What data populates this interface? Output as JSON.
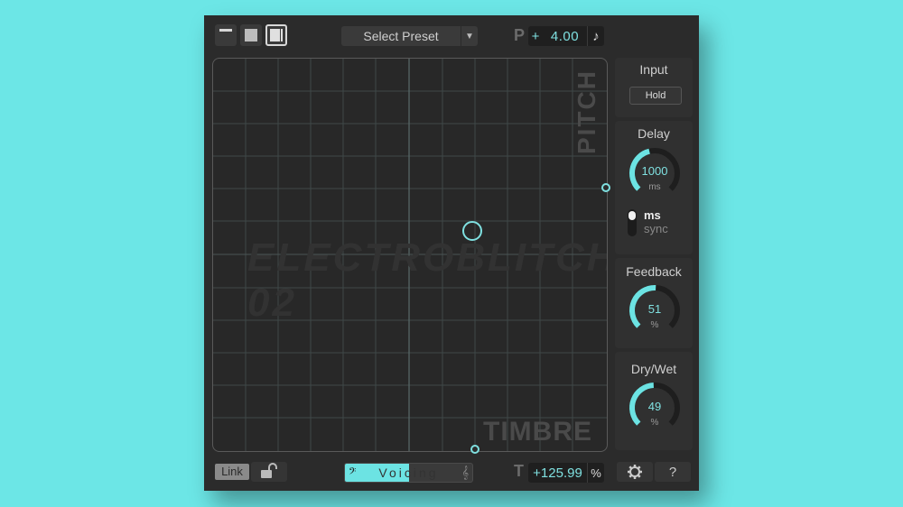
{
  "toolbar": {
    "view_buttons": [
      "minimal-view-icon",
      "medium-view-icon",
      "large-view-icon"
    ],
    "preset_label": "Select Preset",
    "pitch_letter": "P",
    "pitch_sign": "+",
    "pitch_value": "4.00",
    "pitch_unit_icon": "♪"
  },
  "pad": {
    "watermark_pitch": "PITCH",
    "watermark_timbre": "TIMBRE",
    "watermark_logo": "ELECTROBLITCH 02"
  },
  "side": {
    "input": {
      "title": "Input",
      "hold_label": "Hold"
    },
    "delay": {
      "title": "Delay",
      "value": "1000",
      "unit": "ms",
      "level": 0.45
    },
    "delay_mode": {
      "option_on": "ms",
      "option_off": "sync"
    },
    "feedback": {
      "title": "Feedback",
      "value": "51",
      "unit": "%",
      "level": 0.51
    },
    "drywet": {
      "title": "Dry/Wet",
      "value": "49",
      "unit": "%",
      "level": 0.49
    }
  },
  "bottom": {
    "link_label": "Link",
    "voicing_label": "Voicing",
    "voicing_level": 0.5,
    "clef_left": "𝄢",
    "clef_right": "𝄞",
    "timbre_letter": "T",
    "timbre_value": "+125.99",
    "timbre_unit": "%",
    "help_label": "?"
  },
  "colors": {
    "accent": "#6ce3e3",
    "panel": "#2b2b2b",
    "background": "#6ce6e6"
  }
}
